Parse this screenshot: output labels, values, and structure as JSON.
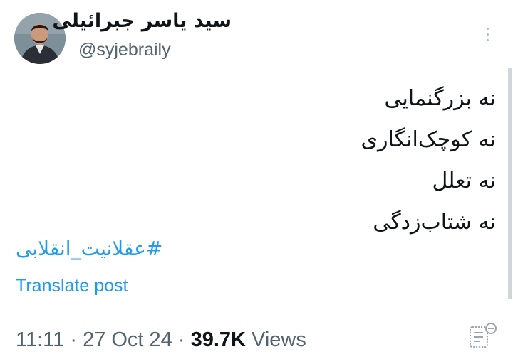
{
  "author": {
    "display_name": "سید یاسر جبرائیلی",
    "handle": "@syjebraily"
  },
  "tweet": {
    "lines": [
      "نه بزرگنمایی",
      "نه کوچک‌انگاری",
      "نه تعلل",
      "نه شتاب‌زدگی"
    ],
    "hashtag": "#عقلانیت_انقلابی",
    "translate_label": "Translate post"
  },
  "meta": {
    "time": "11:11",
    "separator": " · ",
    "date": "27 Oct 24",
    "views_count": "39.7K",
    "views_label": " Views"
  },
  "colors": {
    "link": "#1d9bf0",
    "secondary_text": "#536471",
    "primary_text": "#0f1419"
  },
  "icons": {
    "more": "more-vertical-icon",
    "analytics": "post-analytics-icon"
  }
}
